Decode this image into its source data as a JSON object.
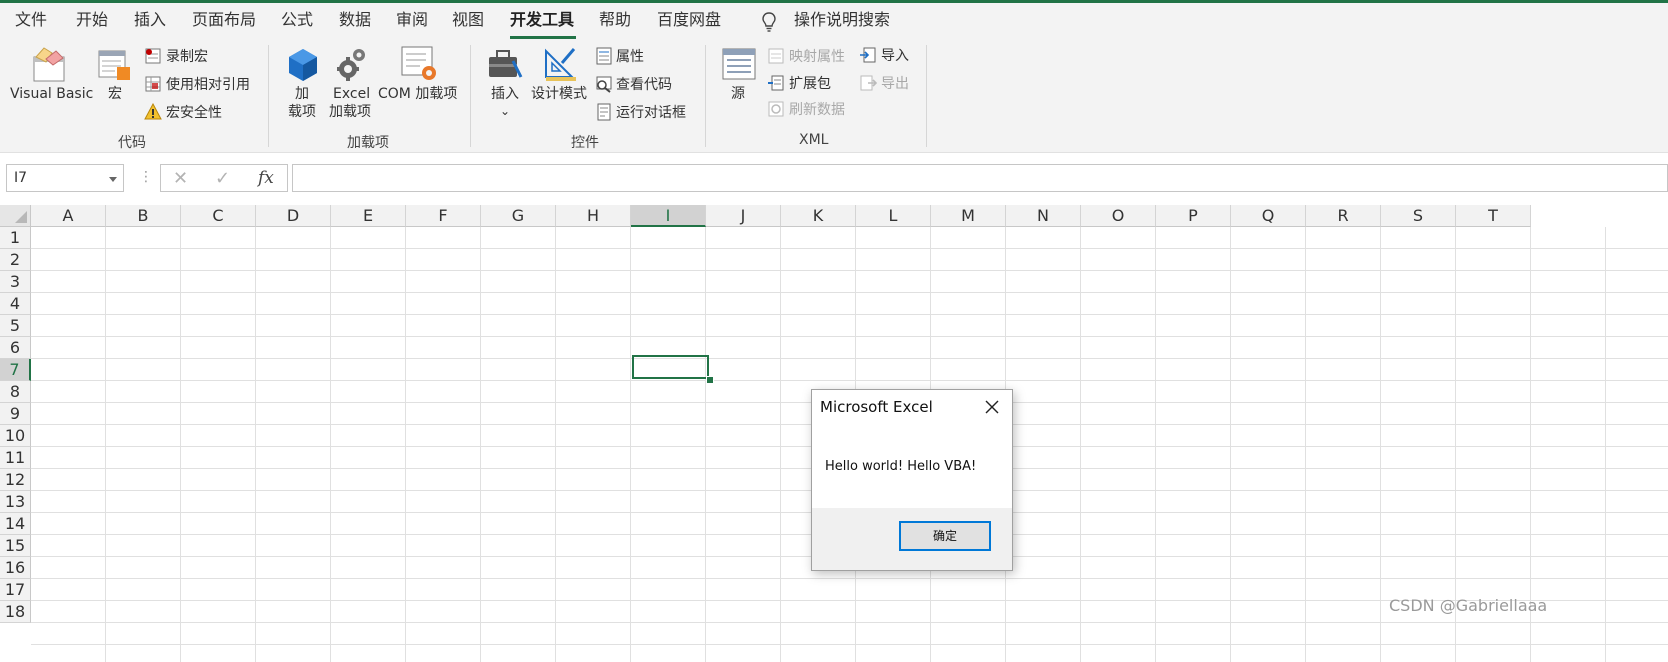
{
  "tabs": [
    "文件",
    "开始",
    "插入",
    "页面布局",
    "公式",
    "数据",
    "审阅",
    "视图",
    "开发工具",
    "帮助",
    "百度网盘"
  ],
  "active_tab": "开发工具",
  "search_label": "操作说明搜索",
  "ribbon": {
    "code": {
      "visual_basic": "Visual Basic",
      "macros": "宏",
      "record_macro": "录制宏",
      "use_relative": "使用相对引用",
      "macro_security": "宏安全性",
      "group_label": "代码"
    },
    "addins": {
      "addins_line1": "加",
      "addins_line2": "载项",
      "excel_line1": "Excel",
      "excel_line2": "加载项",
      "com": "COM 加载项",
      "group_label": "加载项"
    },
    "controls": {
      "insert": "插入",
      "insert_arrow": "⌄",
      "design_mode": "设计模式",
      "properties": "属性",
      "view_code": "查看代码",
      "run_dialog": "运行对话框",
      "group_label": "控件"
    },
    "xml": {
      "source": "源",
      "map_properties": "映射属性",
      "expansion_packs": "扩展包",
      "refresh_data": "刷新数据",
      "import": "导入",
      "export": "导出",
      "group_label": "XML"
    }
  },
  "formula_bar": {
    "name_box": "I7",
    "dots": "⋮",
    "cancel": "✕",
    "enter": "✓",
    "fx": "fx",
    "formula": ""
  },
  "columns": [
    "A",
    "B",
    "C",
    "D",
    "E",
    "F",
    "G",
    "H",
    "I",
    "J",
    "K",
    "L",
    "M",
    "N",
    "O",
    "P",
    "Q",
    "R",
    "S",
    "T"
  ],
  "rows": [
    "1",
    "2",
    "3",
    "4",
    "5",
    "6",
    "7",
    "8",
    "9",
    "10",
    "11",
    "12",
    "13",
    "14",
    "15",
    "16",
    "17",
    "18"
  ],
  "selected": {
    "column": "I",
    "row": "7"
  },
  "dialog": {
    "title": "Microsoft Excel",
    "message": "Hello world! Hello VBA!",
    "ok": "确定"
  },
  "watermark": "CSDN @Gabriellaaa",
  "colors": {
    "accent": "#217346",
    "dialog_focus": "#0078d7"
  }
}
